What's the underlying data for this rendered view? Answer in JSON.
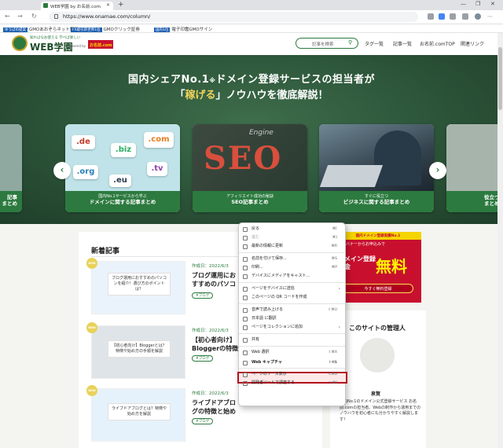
{
  "browser": {
    "tab_title": "WEB学園 by お名前.com",
    "tab_close": "✕",
    "new_tab": "+",
    "url": "https://www.onamae.com/column/",
    "window_controls": [
      "—",
      "❐",
      "✕"
    ],
    "bookmarks": [
      {
        "tag": "ゆうぱの提案",
        "label": "GMOあおぞらネット銀行"
      },
      {
        "tag": "FX取引新世界1位",
        "label": "GMOクリック証券"
      },
      {
        "tag": "国内1位",
        "label": "電子印鑑GMOサイン"
      }
    ]
  },
  "site": {
    "logo_tagline": "知ればなお使える 学べば楽しい",
    "logo_name": "WEB学園",
    "powered_by": "Powered by",
    "brand": "お名前.com",
    "search_placeholder": "記事を検索",
    "nav": [
      "タグ一覧",
      "記事一覧",
      "お名前.comTOP",
      "関連リンク"
    ]
  },
  "hero": {
    "line1_pre": "国内シェアNo.1",
    "line1_mid": "※",
    "line1_post": "ドメイン登録サービスの担当者が",
    "line2_open": "「",
    "line2_hl": "稼げる",
    "line2_close": "」",
    "line2_post": "ノウハウを徹底解説！",
    "cards": [
      {
        "sub": "国内No.1サービスから学ぶ",
        "title": "ドメインに関する記事まとめ",
        "bubbles": [
          ".de",
          ".biz",
          ".com",
          ".org",
          ".eu",
          ".tv"
        ]
      },
      {
        "sub": "アフィリエイト成功の秘訣",
        "title": "SEO記事まとめ",
        "img_text": "SEO",
        "img_sub": "Engine"
      },
      {
        "sub": "すぐに役立つ",
        "title": "ビジネスに関する記事まとめ"
      }
    ],
    "left_peek": [
      "記事",
      "まとめ"
    ],
    "right_peek": [
      "役立つ情報",
      "まとめ"
    ],
    "prev": "‹",
    "next": "›"
  },
  "main": {
    "section_title": "新着記事",
    "new_badge": "NEW",
    "articles": [
      {
        "date": "作成日：2022/6/3",
        "title": "ブログ運用におすすめのパソコン選び方のポイントは？",
        "tag": "#ブログ",
        "thumb": "ブログ運用におすすめのパソコンを紹介！選び方のポイントは？"
      },
      {
        "date": "作成日：2022/6/3",
        "title": "【初心者向け】Bloggerの特徴と手順を解説",
        "tag": "#ブログ",
        "thumb": "【初心者向け】Bloggerとは？特徴や始め方の手順を解説"
      },
      {
        "date": "作成日：2022/6/3",
        "title": "ライブドアブログの特徴と始め方を解説",
        "tag": "#ブログ",
        "thumb": "ライブドアブログとは？特徴や始め方を解説"
      }
    ]
  },
  "sidebar": {
    "ad_top": "国内ドメイン登録実績No.1",
    "ad_line": "このバナーからお申込みで",
    "ad_main": "ドメイン登録料金",
    "ad_big": "無料",
    "ad_button": "今すぐ無料登録",
    "admin_title": "このサイトの管理人",
    "admin_name": "泉賀",
    "admin_desc": "国内No.1のドメイン公式登録サービス お名前.comの担当者。Webの制作から運用までのノウハウを初心者にも分かりやすく解説します！"
  },
  "context_menu": {
    "items": [
      {
        "label": "戻る",
        "shortcut": "⌘[",
        "disabled": false
      },
      {
        "label": "進む",
        "shortcut": "⌘]",
        "disabled": true
      },
      {
        "label": "最新の情報に更新",
        "shortcut": "⌘R",
        "disabled": false
      },
      {
        "sep": true
      },
      {
        "label": "名前を付けて保存...",
        "shortcut": "⌘S",
        "disabled": false
      },
      {
        "label": "印刷...",
        "shortcut": "⌘P",
        "disabled": false
      },
      {
        "label": "デバイスにメディアをキャスト...",
        "shortcut": "",
        "disabled": false
      },
      {
        "sep": true
      },
      {
        "label": "ページをデバイスに送信",
        "shortcut": "",
        "submenu": true,
        "disabled": false
      },
      {
        "label": "このページの QR コードを作成",
        "shortcut": "",
        "disabled": false
      },
      {
        "sep": true
      },
      {
        "label": "音声で読み上げる",
        "shortcut": "⇧⌘U",
        "disabled": false
      },
      {
        "label": "日本語 に翻訳",
        "shortcut": "",
        "disabled": false
      },
      {
        "label": "ページをコレクションに追加",
        "shortcut": "",
        "submenu": true,
        "disabled": false
      },
      {
        "sep": true
      },
      {
        "label": "共有",
        "shortcut": "",
        "disabled": false
      },
      {
        "sep": true
      },
      {
        "label": "Web 選択",
        "shortcut": "⇧⌘X",
        "disabled": false
      },
      {
        "label": "Web キャプチャ",
        "shortcut": "⇧⌘S",
        "disabled": false,
        "highlighted": true
      },
      {
        "sep": true
      },
      {
        "label": "ページのソース表示",
        "shortcut": "⌥⌘U",
        "disabled": false
      },
      {
        "label": "開発者ツールで調査する",
        "shortcut": "⌥⌘I",
        "disabled": false
      }
    ]
  },
  "colors": {
    "brand_green": "#2c7a3f",
    "highlight_red": "#b4121c",
    "ad_red": "#c8102e",
    "hero_yellow": "#f2d45c"
  }
}
